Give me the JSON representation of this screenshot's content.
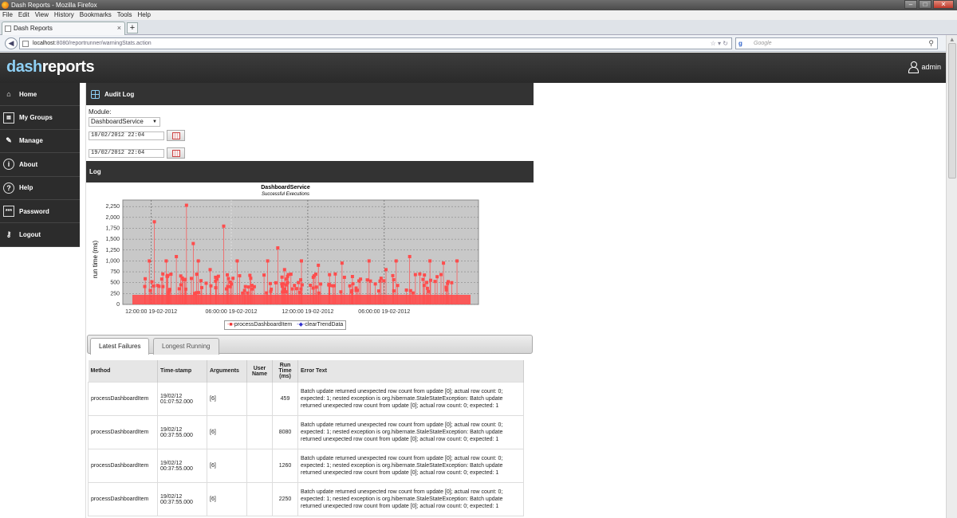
{
  "window": {
    "title": "Dash Reports - Mozilla Firefox",
    "controls": [
      "–",
      "□",
      "✕"
    ]
  },
  "menu": [
    "File",
    "Edit",
    "View",
    "History",
    "Bookmarks",
    "Tools",
    "Help"
  ],
  "browser": {
    "tab_title": "Dash Reports",
    "tab_close": "×",
    "new_tab": "+",
    "url_host": "localhost",
    "url_path": ":8080/reportrunner/warningStats.action",
    "search_engine": "Google",
    "search_placeholder": "Google"
  },
  "app": {
    "logo_dash": "dash",
    "logo_reports": "reports",
    "user": "admin"
  },
  "sidebar": {
    "items": [
      {
        "label": "Home",
        "icon": "home-icon"
      },
      {
        "label": "My Groups",
        "icon": "groups-icon"
      },
      {
        "label": "Manage",
        "icon": "wrench-icon"
      },
      {
        "label": "About",
        "icon": "info-icon"
      },
      {
        "label": "Help",
        "icon": "help-icon"
      },
      {
        "label": "Password",
        "icon": "password-icon"
      },
      {
        "label": "Logout",
        "icon": "logout-icon"
      }
    ]
  },
  "audit": {
    "title": "Audit Log",
    "module_label": "Module:",
    "module_value": "DashboardService",
    "date_from": "18/02/2012 22:04",
    "date_to": "19/02/2012 22:04",
    "log_title": "Log"
  },
  "chart_data": {
    "type": "line",
    "title": "DashboardService",
    "subtitle": "Successful Executions",
    "ylabel": "run time (ms)",
    "ylim": [
      0,
      2400
    ],
    "yticks": [
      "0",
      "250",
      "500",
      "750",
      "1,000",
      "1,250",
      "1,500",
      "1,750",
      "2,000",
      "2,250"
    ],
    "xticks": [
      "12:00:00 19-02-2012",
      "06:00:00 19-02-2012",
      "12:00:00 19-02-2012",
      "06:00:00 19-02-2012"
    ],
    "series": [
      {
        "name": "processDashboardItem",
        "color": "#ff4d4d"
      },
      {
        "name": "clearTrendData",
        "color": "#3333cc"
      }
    ],
    "background": "#c8c8c8"
  },
  "tabs": [
    "Latest Failures",
    "Longest Running"
  ],
  "table": {
    "headers": [
      "Method",
      "Time-stamp",
      "Arguments",
      "User Name",
      "Run Time (ms)",
      "Error Text"
    ],
    "rows": [
      {
        "method": "processDashboardItem",
        "ts1": "19/02/12",
        "ts2": "01:07:52.000",
        "args": "[6]",
        "user": "",
        "run": "459",
        "error": "Batch update returned unexpected row count from update [0]; actual row count: 0; expected: 1; nested exception is org.hibernate.StaleStateException: Batch update returned unexpected row count from update [0]; actual row count: 0; expected: 1"
      },
      {
        "method": "processDashboardItem",
        "ts1": "19/02/12",
        "ts2": "00:37:55.000",
        "args": "[6]",
        "user": "",
        "run": "8080",
        "error": "Batch update returned unexpected row count from update [0]; actual row count: 0; expected: 1; nested exception is org.hibernate.StaleStateException: Batch update returned unexpected row count from update [0]; actual row count: 0; expected: 1"
      },
      {
        "method": "processDashboardItem",
        "ts1": "19/02/12",
        "ts2": "00:37:55.000",
        "args": "[6]",
        "user": "",
        "run": "1260",
        "error": "Batch update returned unexpected row count from update [0]; actual row count: 0; expected: 1; nested exception is org.hibernate.StaleStateException: Batch update returned unexpected row count from update [0]; actual row count: 0; expected: 1"
      },
      {
        "method": "processDashboardItem",
        "ts1": "19/02/12",
        "ts2": "00:37:55.000",
        "args": "[6]",
        "user": "",
        "run": "2250",
        "error": "Batch update returned unexpected row count from update [0]; actual row count: 0; expected: 1; nested exception is org.hibernate.StaleStateException: Batch update returned unexpected row count from update [0]; actual row count: 0; expected: 1"
      }
    ]
  }
}
